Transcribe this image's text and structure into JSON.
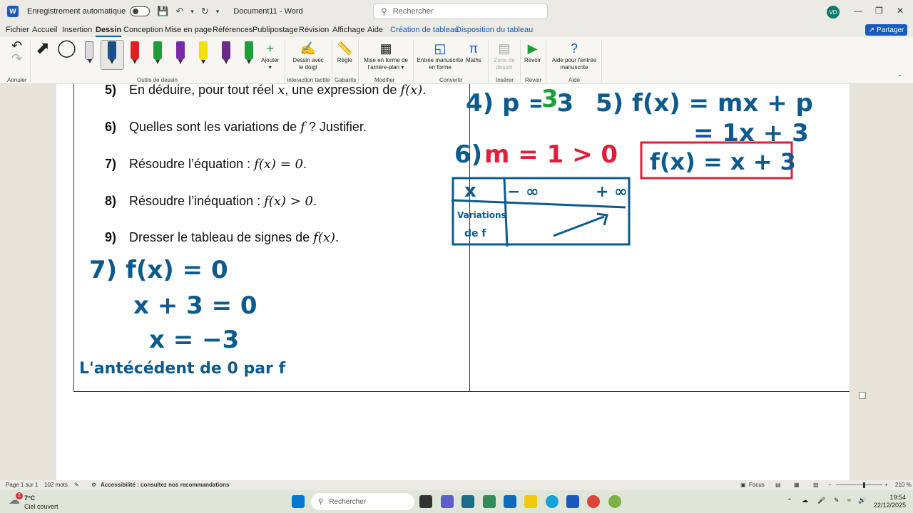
{
  "titlebar": {
    "autosave_label": "Enregistrement automatique",
    "doc_title": "Document11  -  Word",
    "search_placeholder": "Rechercher",
    "avatar_initials": "VD"
  },
  "menu": {
    "tabs": [
      "Fichier",
      "Accueil",
      "Insertion",
      "Dessin",
      "Conception",
      "Mise en page",
      "Références",
      "Publipostage",
      "Révision",
      "Affichage",
      "Aide",
      "Création de tableau",
      "Disposition du tableau"
    ],
    "active_tab": "Dessin",
    "share_label": "Partager"
  },
  "ribbon": {
    "groups": {
      "annuler": "Annuler",
      "outils": "Outils de dessin",
      "interaction": "Interaction tactile",
      "gabarits": "Gabarits",
      "modifier": "Modifier",
      "convertir": "Convertir",
      "inserer": "Insérer",
      "revoir": "Revoir",
      "aide": "Aide"
    },
    "buttons": {
      "ajouter": "Ajouter",
      "dessin_doigt": "Dessin avec le doigt",
      "regle": "Règle",
      "mise_forme": "Mise en forme de l'arrière-plan",
      "entree_manuscrite": "Entrée manuscrite en forme",
      "maths": "Maths",
      "zone_dessin": "Zone de dessin",
      "revoir": "Revoir",
      "aide_entree": "Aide pour l'entrée manuscrite"
    },
    "pen_colors": [
      "#555555",
      "#1a4e8c",
      "#e02020",
      "#1f9d3a",
      "#7a2aa8",
      "#f2e000",
      "#6a2a8a",
      "#1f9d3a"
    ]
  },
  "document": {
    "questions": [
      {
        "num": "5)",
        "pre": "En déduire, pour tout réel ",
        "math": "x",
        "post": ", une expression de ",
        "math2": "f(x)",
        "post2": "."
      },
      {
        "num": "6)",
        "pre": "Quelles sont les variations de ",
        "math": "f",
        "post": " ? Justifier.",
        "math2": "",
        "post2": ""
      },
      {
        "num": "7)",
        "pre": "Résoudre l’équation : ",
        "math": "f(x) = 0",
        "post": ".",
        "math2": "",
        "post2": ""
      },
      {
        "num": "8)",
        "pre": "Résoudre l’inéquation : ",
        "math": "f(x) > 0",
        "post": ".",
        "math2": "",
        "post2": ""
      },
      {
        "num": "9)",
        "pre": "Dresser le tableau de signes de ",
        "math": "f(x)",
        "post": ".",
        "math2": "",
        "post2": ""
      }
    ],
    "handwriting": {
      "q4": "4) p = 3",
      "q5_line1": "5) f(x) = mx + p",
      "q5_line2": "= 1x + 3",
      "q5_boxed": "f(x) = x + 3",
      "q6": "6) m = 1 > 0",
      "table_x": "x",
      "table_minf": "− ∞",
      "table_pinf": "+ ∞",
      "table_var_label": "Variations de f",
      "q7_line1": "7) f(x) = 0",
      "q7_line2": "x + 3 = 0",
      "q7_line3": "x = −3",
      "q7_note": "L'antécédent de 0 par f"
    }
  },
  "status": {
    "page": "Page 1 sur 1",
    "words": "102 mots",
    "accessibility": "Accessibilité : consultez nos recommandations",
    "focus": "Focus",
    "zoom": "210 %"
  },
  "taskbar": {
    "temperature": "7°C",
    "weather": "Ciel couvert",
    "search_placeholder": "Rechercher",
    "time": "19:54",
    "date": "22/12/2025",
    "notification_count": "2"
  },
  "colors": {
    "ink_blue": "#0d5a8c",
    "ink_green": "#1f9d3a",
    "ink_red": "#e0203a",
    "accent": "#185abd"
  }
}
